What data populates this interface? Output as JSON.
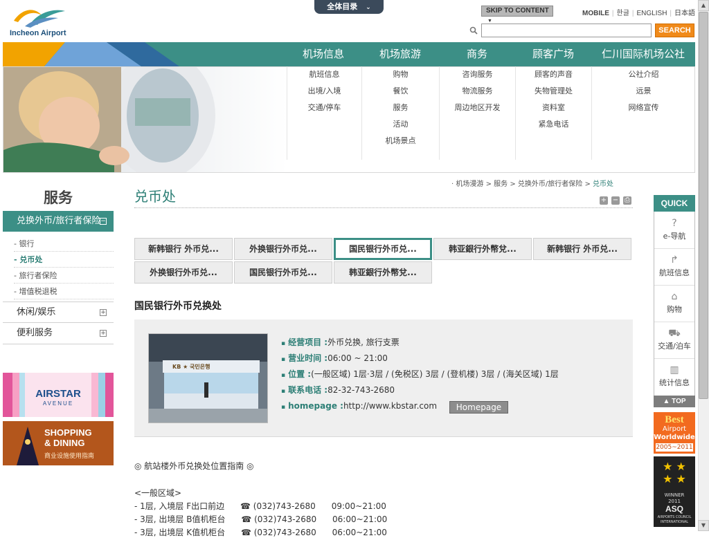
{
  "header": {
    "logo_text": "Incheon Airport",
    "all_menu": "全体目录",
    "skip_to_content": "SKIP TO CONTENT",
    "languages": [
      "MOBILE",
      "한글",
      "ENGLISH",
      "日本語"
    ],
    "search_placeholder": "",
    "search_button": "SEARCH"
  },
  "nav": {
    "top": [
      "机场信息",
      "机场旅游",
      "商务",
      "顾客广场",
      "仁川国际机场公社"
    ],
    "sub": [
      [
        "航班信息",
        "出境/入境",
        "交通/停车"
      ],
      [
        "购物",
        "餐饮",
        "服务",
        "活动",
        "机场景点"
      ],
      [
        "咨询服务",
        "物流服务",
        "周边地区开发"
      ],
      [
        "顾客的声音",
        "失物管理处",
        "资料室",
        "紧急电话"
      ],
      [
        "公社介绍",
        "远景",
        "网络宣传"
      ]
    ]
  },
  "sidebar": {
    "title": "服务",
    "active_label": "兑换外币/旅行者保险",
    "active_toggle": "−",
    "sub_items": [
      "银行",
      "兑币处",
      "旅行者保险",
      "增值税退税"
    ],
    "sub_bullet": "-",
    "items": [
      "休闲/娱乐",
      "便利服务"
    ],
    "expand_symbol": "+",
    "banner1_title": "AIRSTAR",
    "banner1_sub": "AVENUE",
    "banner2_title": "SHOPPING",
    "banner2_title2": "& DINING",
    "banner2_sub": "商业设施使用指南"
  },
  "breadcrumb": {
    "bullet": "·",
    "items": [
      "机场漫游",
      "服务",
      "兑换外币/旅行者保险"
    ],
    "separator": ">",
    "current": "兑币处"
  },
  "page_title": "兑币处",
  "toolbar_icons": [
    "+",
    "−",
    "⎙"
  ],
  "tabs": [
    "新韩银行 外币兑...",
    "外换银行外币兑...",
    "国民银行外币兑...",
    "韩亚銀行外幣兌...",
    "新韩银行 外币兑...",
    "外换银行外币兑...",
    "国民银行外币兑...",
    "韩亚銀行外幣兌..."
  ],
  "active_tab_index": 2,
  "section_title": "国民银行外币兑换处",
  "info": {
    "photo_sign": "KB ★ 국민은행",
    "bullet": "▪",
    "rows": [
      {
        "label": "经营项目 :",
        "value": "外币兑换, 旅行支票"
      },
      {
        "label": "营业时间 :",
        "value": "06:00 ~ 21:00"
      },
      {
        "label": "位置 :",
        "value": "(一般区域) 1层·3层 / (免税区) 3层 / (登机楼) 3层 / (海关区域) 1层"
      },
      {
        "label": "联系电话 :",
        "value": "82-32-743-2680"
      },
      {
        "label": "homepage :",
        "value": "http://www.kbstar.com"
      }
    ],
    "homepage_button": "Homepage"
  },
  "body": {
    "guide_title": "◎ 航站楼外币兑换处位置指南 ◎",
    "area_label": "<一般区域>",
    "lines": [
      "- 1层, 入境层 F出口前边      ☎ (032)743-2680      09:00~21:00",
      "- 3层, 出境层 B值机柜台      ☎ (032)743-2680      06:00~21:00",
      "- 3层, 出境层 K值机柜台      ☎ (032)743-2680      06:00~21:00"
    ]
  },
  "quick": {
    "title": "QUICK",
    "items": [
      {
        "icon": "?",
        "label": "e-导航"
      },
      {
        "icon": "↱",
        "label": "航班信息"
      },
      {
        "icon": "⌂",
        "label": "购物"
      },
      {
        "icon": "⛟",
        "label": "交通/泊车"
      },
      {
        "icon": "▥",
        "label": "统计信息"
      }
    ],
    "top": "▲ TOP"
  },
  "awards": {
    "a1_line1": "Best",
    "a1_line2": "Airport",
    "a1_line3": "Worldwide",
    "a1_years": "2005~2011",
    "a2_line1": "WINNER",
    "a2_line2": "2011",
    "a2_line3": "ASQ",
    "a2_line4": "AIRPORTS COUNCIL INTERNATIONAL"
  },
  "colors": {
    "accent": "#3c8f86",
    "orange": "#f08a1a"
  }
}
